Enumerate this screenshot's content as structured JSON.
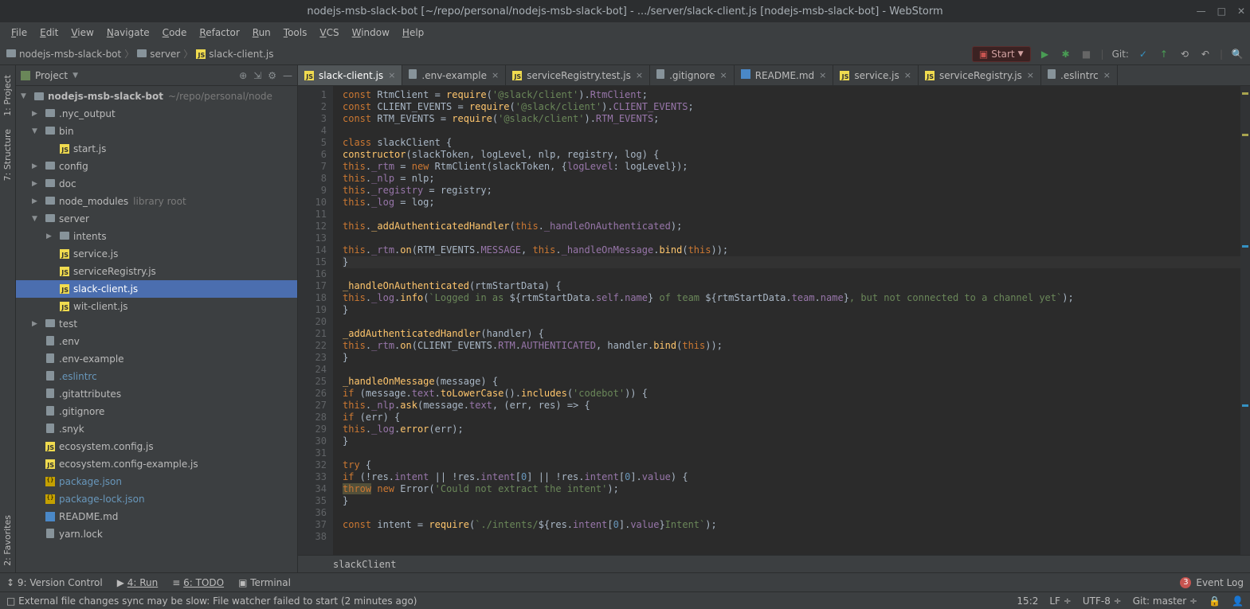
{
  "window": {
    "title": "nodejs-msb-slack-bot [~/repo/personal/nodejs-msb-slack-bot] - .../server/slack-client.js [nodejs-msb-slack-bot] - WebStorm"
  },
  "menu": [
    "File",
    "Edit",
    "View",
    "Navigate",
    "Code",
    "Refactor",
    "Run",
    "Tools",
    "VCS",
    "Window",
    "Help"
  ],
  "breadcrumbs": [
    "nodejs-msb-slack-bot",
    "server",
    "slack-client.js"
  ],
  "run_config": "Start",
  "git_label": "Git:",
  "side_tabs": {
    "project": "1: Project",
    "structure": "7: Structure",
    "favorites": "2: Favorites"
  },
  "project_panel": {
    "title": "Project",
    "root": {
      "name": "nodejs-msb-slack-bot",
      "path": "~/repo/personal/node"
    },
    "tree": [
      {
        "d": 1,
        "arrow": "▶",
        "type": "folder",
        "label": ".nyc_output"
      },
      {
        "d": 1,
        "arrow": "▼",
        "type": "folder",
        "label": "bin"
      },
      {
        "d": 2,
        "arrow": "",
        "type": "js",
        "label": "start.js"
      },
      {
        "d": 1,
        "arrow": "▶",
        "type": "folder",
        "label": "config"
      },
      {
        "d": 1,
        "arrow": "▶",
        "type": "folder",
        "label": "doc"
      },
      {
        "d": 1,
        "arrow": "▶",
        "type": "folder",
        "label": "node_modules",
        "note": "library root"
      },
      {
        "d": 1,
        "arrow": "▼",
        "type": "folder",
        "label": "server"
      },
      {
        "d": 2,
        "arrow": "▶",
        "type": "folder",
        "label": "intents"
      },
      {
        "d": 2,
        "arrow": "",
        "type": "js",
        "label": "service.js"
      },
      {
        "d": 2,
        "arrow": "",
        "type": "js",
        "label": "serviceRegistry.js"
      },
      {
        "d": 2,
        "arrow": "",
        "type": "js",
        "label": "slack-client.js",
        "selected": true
      },
      {
        "d": 2,
        "arrow": "",
        "type": "js",
        "label": "wit-client.js"
      },
      {
        "d": 1,
        "arrow": "▶",
        "type": "folder",
        "label": "test"
      },
      {
        "d": 1,
        "arrow": "",
        "type": "file",
        "label": ".env"
      },
      {
        "d": 1,
        "arrow": "",
        "type": "file",
        "label": ".env-example"
      },
      {
        "d": 1,
        "arrow": "",
        "type": "file",
        "label": ".eslintrc",
        "link": true
      },
      {
        "d": 1,
        "arrow": "",
        "type": "file",
        "label": ".gitattributes"
      },
      {
        "d": 1,
        "arrow": "",
        "type": "file",
        "label": ".gitignore"
      },
      {
        "d": 1,
        "arrow": "",
        "type": "file",
        "label": ".snyk"
      },
      {
        "d": 1,
        "arrow": "",
        "type": "js",
        "label": "ecosystem.config.js"
      },
      {
        "d": 1,
        "arrow": "",
        "type": "js",
        "label": "ecosystem.config-example.js"
      },
      {
        "d": 1,
        "arrow": "",
        "type": "json",
        "label": "package.json",
        "link": true
      },
      {
        "d": 1,
        "arrow": "",
        "type": "json",
        "label": "package-lock.json",
        "link": true
      },
      {
        "d": 1,
        "arrow": "",
        "type": "md",
        "label": "README.md"
      },
      {
        "d": 1,
        "arrow": "",
        "type": "file",
        "label": "yarn.lock"
      }
    ]
  },
  "tabs": [
    {
      "label": "slack-client.js",
      "type": "js",
      "active": true
    },
    {
      "label": ".env-example",
      "type": "file"
    },
    {
      "label": "serviceRegistry.test.js",
      "type": "js"
    },
    {
      "label": ".gitignore",
      "type": "file"
    },
    {
      "label": "README.md",
      "type": "md"
    },
    {
      "label": "service.js",
      "type": "js"
    },
    {
      "label": "serviceRegistry.js",
      "type": "js"
    },
    {
      "label": ".eslintrc",
      "type": "file"
    }
  ],
  "code": {
    "lines": [
      {
        "n": 1,
        "html": "<span class='kw'>const</span> RtmClient = <span class='fn'>require</span>(<span class='str'>'@slack/client'</span>).<span class='mem'>RtmClient</span>;"
      },
      {
        "n": 2,
        "html": "<span class='kw'>const</span> CLIENT_EVENTS = <span class='fn'>require</span>(<span class='str'>'@slack/client'</span>).<span class='mem'>CLIENT_EVENTS</span>;"
      },
      {
        "n": 3,
        "html": "<span class='kw'>const</span> RTM_EVENTS = <span class='fn'>require</span>(<span class='str'>'@slack/client'</span>).<span class='mem'>RTM_EVENTS</span>;"
      },
      {
        "n": 4,
        "html": ""
      },
      {
        "n": 5,
        "html": "<span class='kw'>class</span> slackClient {"
      },
      {
        "n": 6,
        "html": "<span class='fn'>constructor</span>(slackToken, logLevel, nlp, registry, log) {"
      },
      {
        "n": 7,
        "html": "<span class='this'>this</span>.<span class='mem'>_rtm</span> = <span class='kw'>new</span> RtmClient(slackToken, {<span class='mem'>logLevel</span>: logLevel});"
      },
      {
        "n": 8,
        "html": "<span class='this'>this</span>.<span class='mem'>_nlp</span> = nlp;"
      },
      {
        "n": 9,
        "html": "<span class='this'>this</span>.<span class='mem'>_registry</span> = registry;"
      },
      {
        "n": 10,
        "html": "<span class='this'>this</span>.<span class='mem'>_log</span> = log;"
      },
      {
        "n": 11,
        "html": ""
      },
      {
        "n": 12,
        "html": "<span class='this'>this</span>.<span class='fn'>_addAuthenticatedHandler</span>(<span class='this'>this</span>.<span class='mem'>_handleOnAuthenticated</span>);"
      },
      {
        "n": 13,
        "html": ""
      },
      {
        "n": 14,
        "html": "<span class='this'>this</span>.<span class='mem'>_rtm</span>.<span class='fn'>on</span>(RTM_EVENTS.<span class='mem'>MESSAGE</span>, <span class='this'>this</span>.<span class='mem'>_handleOnMessage</span>.<span class='fn'>bind</span>(<span class='this'>this</span>));"
      },
      {
        "n": 15,
        "html": "}",
        "current": true
      },
      {
        "n": 16,
        "html": ""
      },
      {
        "n": 17,
        "html": "<span class='fn'>_handleOnAuthenticated</span>(rtmStartData) {"
      },
      {
        "n": 18,
        "html": "<span class='this'>this</span>.<span class='mem'>_log</span>.<span class='fn'>info</span>(<span class='str'>`Logged in as </span>${rtmStartData.<span class='mem'>self</span>.<span class='mem'>name</span>}<span class='str'> of team </span>${rtmStartData.<span class='mem'>team</span>.<span class='mem'>name</span>}<span class='str'>, but not connected to a channel yet`</span>);"
      },
      {
        "n": 19,
        "html": "}"
      },
      {
        "n": 20,
        "html": ""
      },
      {
        "n": 21,
        "html": "<span class='fn'>_addAuthenticatedHandler</span>(handler) {"
      },
      {
        "n": 22,
        "html": "<span class='this'>this</span>.<span class='mem'>_rtm</span>.<span class='fn'>on</span>(CLIENT_EVENTS.<span class='mem'>RTM</span>.<span class='mem'>AUTHENTICATED</span>, handler.<span class='fn'>bind</span>(<span class='this'>this</span>));"
      },
      {
        "n": 23,
        "html": "}"
      },
      {
        "n": 24,
        "html": ""
      },
      {
        "n": 25,
        "html": "<span class='fn'>_handleOnMessage</span>(message) {"
      },
      {
        "n": 26,
        "html": "<span class='kw'>if</span> (message.<span class='mem'>text</span>.<span class='fn'>toLowerCase</span>().<span class='fn'>includes</span>(<span class='str'>'codebot'</span>)) {"
      },
      {
        "n": 27,
        "html": "<span class='this'>this</span>.<span class='mem'>_nlp</span>.<span class='fn'>ask</span>(message.<span class='mem'>text</span>, (err, res) => {"
      },
      {
        "n": 28,
        "html": "<span class='kw'>if</span> (err) {"
      },
      {
        "n": 29,
        "html": "<span class='this'>this</span>.<span class='mem'>_log</span>.<span class='fn'>error</span>(err);"
      },
      {
        "n": 30,
        "html": "}"
      },
      {
        "n": 31,
        "html": ""
      },
      {
        "n": 32,
        "html": "<span class='kw'>try</span> {"
      },
      {
        "n": 33,
        "html": "<span class='kw'>if</span> (!res.<span class='mem'>intent</span> || !res.<span class='mem'>intent</span>[<span class='num'>0</span>] || !res.<span class='mem'>intent</span>[<span class='num'>0</span>].<span class='mem'>value</span>) {"
      },
      {
        "n": 34,
        "html": "<span class='kw' style='background:#52503a'>throw</span> <span class='kw'>new</span> Error(<span class='str'>'Could not extract the intent'</span>);"
      },
      {
        "n": 35,
        "html": "}"
      },
      {
        "n": 36,
        "html": ""
      },
      {
        "n": 37,
        "html": "<span class='kw'>const</span> intent = <span class='fn'>require</span>(<span class='str'>`./intents/</span>${res.<span class='mem'>intent</span>[<span class='num'>0</span>].<span class='mem'>value</span>}<span class='str'>Intent`</span>);"
      },
      {
        "n": 38,
        "html": ""
      }
    ],
    "breadcrumb": "slackClient"
  },
  "bottom_tools": {
    "vc": "9: Version Control",
    "run": "4: Run",
    "todo": "6: TODO",
    "terminal": "Terminal",
    "event_log": "Event Log",
    "event_count": "3"
  },
  "status": {
    "message": "External file changes sync may be slow: File watcher failed to start (2 minutes ago)",
    "pos": "15:2",
    "le": "LF",
    "enc": "UTF-8",
    "git": "Git: master"
  }
}
